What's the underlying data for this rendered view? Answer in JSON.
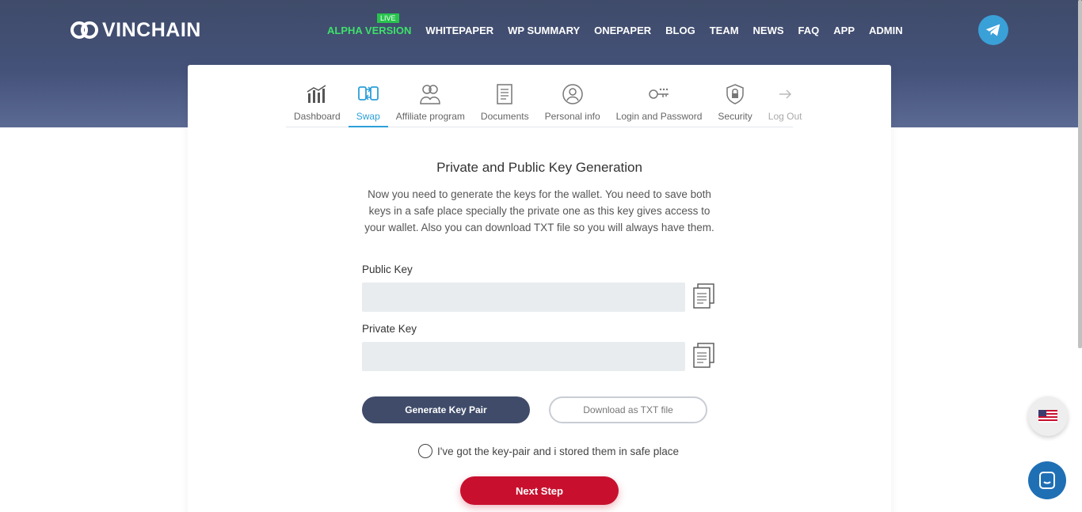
{
  "brand": {
    "name": "VINCHAIN"
  },
  "nav": {
    "live_badge": "LIVE",
    "items": [
      {
        "label": "ALPHA VERSION",
        "active": true
      },
      {
        "label": "WHITEPAPER"
      },
      {
        "label": "WP SUMMARY"
      },
      {
        "label": "ONEPAPER"
      },
      {
        "label": "BLOG"
      },
      {
        "label": "TEAM"
      },
      {
        "label": "NEWS"
      },
      {
        "label": "FAQ"
      },
      {
        "label": "APP"
      },
      {
        "label": "ADMIN"
      }
    ]
  },
  "tabs": [
    {
      "label": "Dashboard",
      "icon": "chart-icon"
    },
    {
      "label": "Swap",
      "icon": "swap-icon",
      "active": true
    },
    {
      "label": "Affiliate program",
      "icon": "users-icon"
    },
    {
      "label": "Documents",
      "icon": "document-icon"
    },
    {
      "label": "Personal info",
      "icon": "user-icon"
    },
    {
      "label": "Login and Password",
      "icon": "key-icon"
    },
    {
      "label": "Security",
      "icon": "shield-icon"
    },
    {
      "label": "Log Out",
      "icon": "arrow-right-icon",
      "disabled": true
    }
  ],
  "content": {
    "title": "Private and Public Key Generation",
    "description": "Now you need to generate the keys for the wallet. You need to save both keys in a safe place specially the private one as this key gives access to your wallet. Also you can download TXT file so you will always have them.",
    "public_key_label": "Public Key",
    "public_key_value": "",
    "private_key_label": "Private Key",
    "private_key_value": "",
    "generate_button": "Generate Key Pair",
    "download_button": "Download as TXT file",
    "confirm_checkbox": "I've got the key-pair and i stored them in safe place",
    "next_button": "Next Step"
  },
  "colors": {
    "header": "#3f4b69",
    "accent": "#2c9fd9",
    "live": "#27c44d",
    "danger": "#c8102e"
  }
}
